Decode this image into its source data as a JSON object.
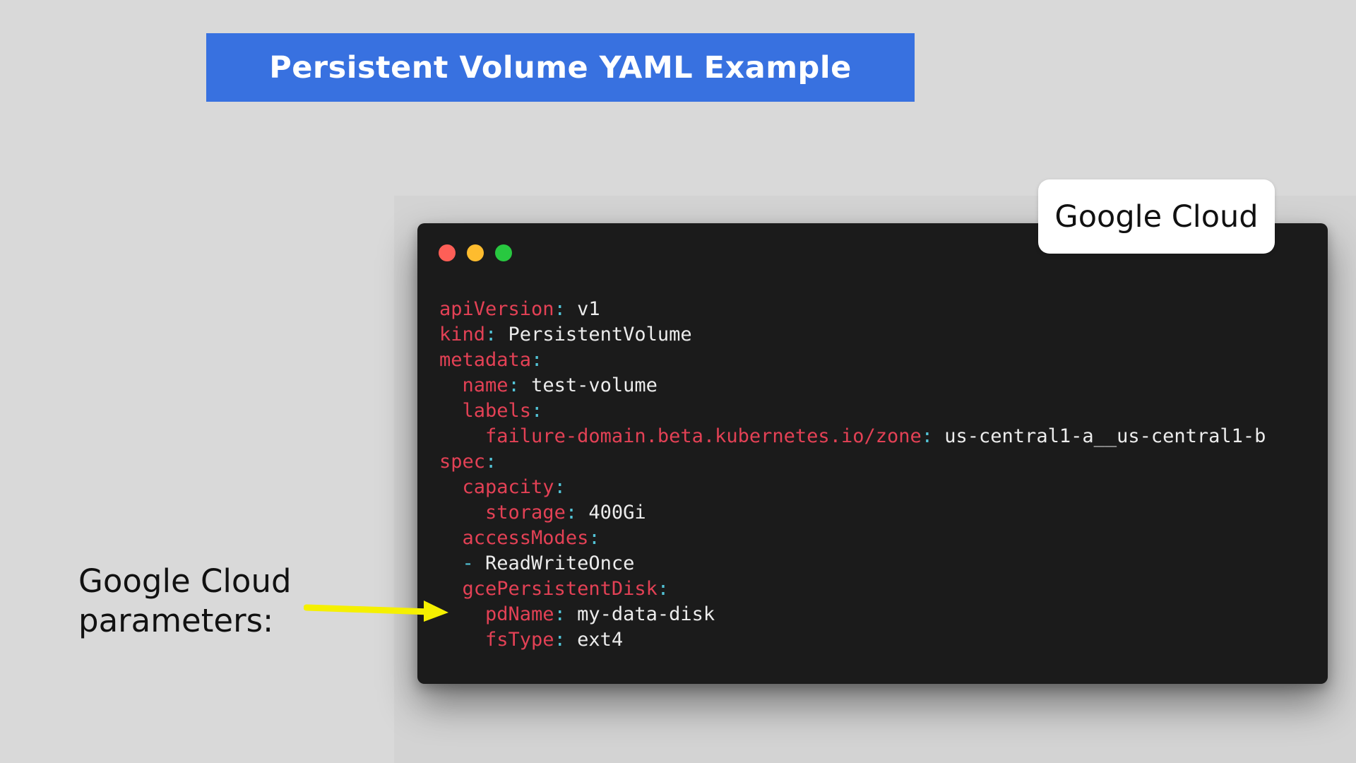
{
  "title": "Persistent Volume YAML Example",
  "badge": "Google Cloud",
  "side_label": {
    "line1": "Google Cloud",
    "line2": "parameters:"
  },
  "colors": {
    "banner": "#3871e0",
    "code_bg": "#1b1b1b",
    "yaml_key": "#e34155",
    "yaml_punct": "#52c3d6",
    "yaml_value": "#ececec",
    "arrow": "#f5f000",
    "dot_red": "#fe5f57",
    "dot_yellow": "#febc2e",
    "dot_green": "#28c840"
  },
  "window_controls": [
    "close-dot",
    "minimize-dot",
    "maximize-dot"
  ],
  "code_lines": [
    {
      "indent": "",
      "key": "apiVersion",
      "sep": ":",
      "value": " v1"
    },
    {
      "indent": "",
      "key": "kind",
      "sep": ":",
      "value": " PersistentVolume"
    },
    {
      "indent": "",
      "key": "metadata",
      "sep": ":",
      "value": ""
    },
    {
      "indent": "  ",
      "key": "name",
      "sep": ":",
      "value": " test-volume"
    },
    {
      "indent": "  ",
      "key": "labels",
      "sep": ":",
      "value": ""
    },
    {
      "indent": "    ",
      "key": "failure-domain.beta.kubernetes.io/zone",
      "sep": ":",
      "value": " us-central1-a__us-central1-b"
    },
    {
      "indent": "",
      "key": "spec",
      "sep": ":",
      "value": ""
    },
    {
      "indent": "  ",
      "key": "capacity",
      "sep": ":",
      "value": ""
    },
    {
      "indent": "    ",
      "key": "storage",
      "sep": ":",
      "value": " 400Gi"
    },
    {
      "indent": "  ",
      "key": "accessModes",
      "sep": ":",
      "value": ""
    },
    {
      "indent": "  ",
      "key": "",
      "sep": "-",
      "value": " ReadWriteOnce"
    },
    {
      "indent": "  ",
      "key": "gcePersistentDisk",
      "sep": ":",
      "value": ""
    },
    {
      "indent": "    ",
      "key": "pdName",
      "sep": ":",
      "value": " my-data-disk"
    },
    {
      "indent": "    ",
      "key": "fsType",
      "sep": ":",
      "value": " ext4"
    }
  ]
}
